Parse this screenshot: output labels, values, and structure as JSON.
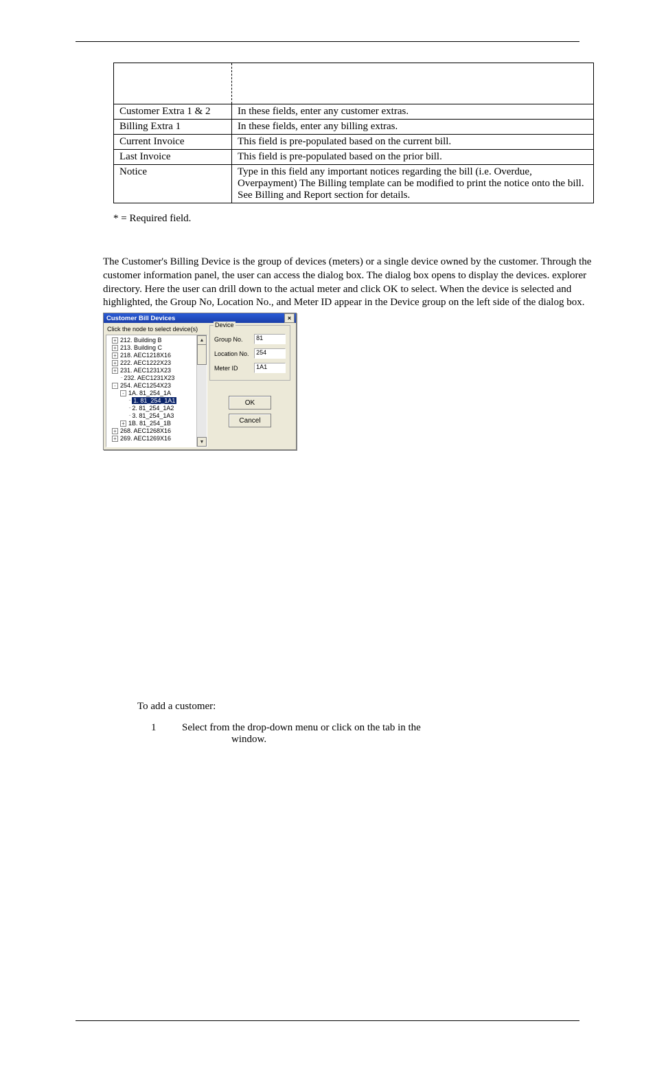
{
  "table": {
    "rows": [
      {
        "field": "Customer Extra 1 & 2",
        "desc": "In these fields, enter any customer extras."
      },
      {
        "field": "Billing Extra 1",
        "desc": "In these fields, enter any billing extras."
      },
      {
        "field": "Current Invoice",
        "desc": "This field is pre-populated based on the current bill."
      },
      {
        "field": "Last Invoice",
        "desc": "This field is pre-populated based on the prior bill."
      },
      {
        "field": "Notice",
        "desc": "Type in this field any important notices regarding the bill (i.e. Overdue, Overpayment) The Billing template can be modified to print the notice onto the bill.  See Billing and Report section for details."
      }
    ]
  },
  "footnote": "* = Required field.",
  "para": {
    "p1a": "The Customer's Billing Device is the group of devices (meters) or a single device owned by the customer. Through the customer information panel, the user can access the ",
    "p1b": " dialog box. The ",
    "p1c": " dialog box opens to display the devices. ",
    "p1d": " explorer directory. Here the user can drill down to the actual meter and click OK to select. When the device is selected and highlighted, the Group No, Location No., and Meter ID appear in the Device group on the left side of the dialog box."
  },
  "dialog": {
    "title": "Customer Bill Devices",
    "instruction": "Click the node to select device(s)",
    "tree": [
      {
        "indent": 0,
        "icon": "+",
        "label": "212. Building B"
      },
      {
        "indent": 0,
        "icon": "+",
        "label": "213. Building C"
      },
      {
        "indent": 0,
        "icon": "+",
        "label": "218. AEC1218X16"
      },
      {
        "indent": 0,
        "icon": "+",
        "label": "222. AEC1222X23"
      },
      {
        "indent": 0,
        "icon": "+",
        "label": "231. AEC1231X23"
      },
      {
        "indent": 1,
        "icon": "",
        "label": "232. AEC1231X23"
      },
      {
        "indent": 0,
        "icon": "-",
        "label": "254. AEC1254X23"
      },
      {
        "indent": 1,
        "icon": "-",
        "label": "1A. 81_254_1A"
      },
      {
        "indent": 2,
        "icon": "",
        "label": "1. 81_254_1A1",
        "sel": true
      },
      {
        "indent": 2,
        "icon": "",
        "label": "2. 81_254_1A2"
      },
      {
        "indent": 2,
        "icon": "",
        "label": "3. 81_254_1A3"
      },
      {
        "indent": 1,
        "icon": "+",
        "label": "1B. 81_254_1B"
      },
      {
        "indent": 0,
        "icon": "+",
        "label": "268. AEC1268X16"
      },
      {
        "indent": 0,
        "icon": "+",
        "label": "269. AEC1269X16"
      }
    ],
    "fields": {
      "legend": "Device",
      "group_label": "Group No.",
      "group_val": "81",
      "loc_label": "Location No.",
      "loc_val": "254",
      "meter_label": "Meter ID",
      "meter_val": "1A1"
    },
    "ok": "OK",
    "cancel": "Cancel"
  },
  "add_heading": "To add a customer:",
  "step1": {
    "num": "1",
    "a": "Select ",
    "b": " from the drop-down menu or click on the ",
    "c": " tab in the ",
    "d": " window."
  }
}
